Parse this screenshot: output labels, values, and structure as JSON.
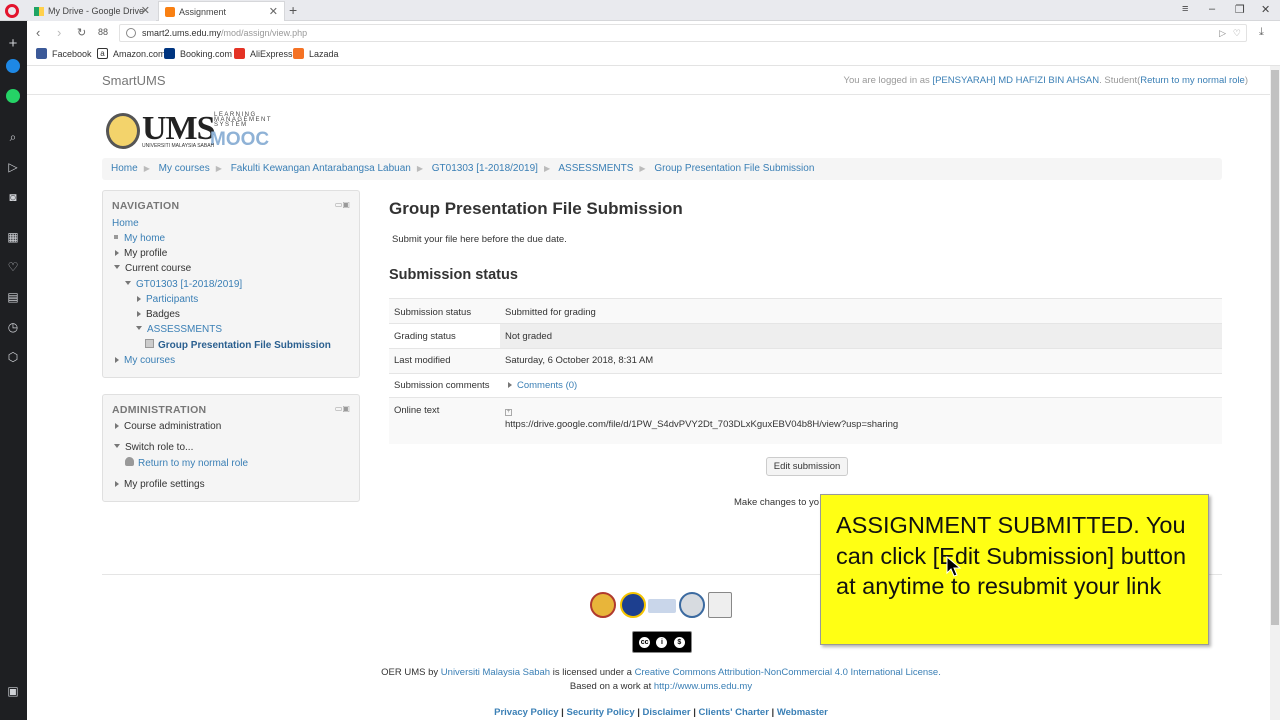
{
  "browser": {
    "tabs": [
      {
        "title": "My Drive - Google Drive",
        "active": false
      },
      {
        "title": "Assignment",
        "active": true
      }
    ],
    "url_host": "smart2.ums.edu.my",
    "url_path": "/mod/assign/view.php",
    "speed_dial": "88",
    "bookmarks": [
      "Facebook",
      "Amazon.com",
      "Booking.com",
      "AliExpress",
      "Lazada"
    ]
  },
  "site": {
    "brand": "SmartUMS",
    "login_prefix": "You are logged in as ",
    "login_user": "[PENSYARAH] MD HAFIZI BIN AHSAN",
    "login_role": ". Student(",
    "login_return": "Return to my normal role",
    "login_close": ")"
  },
  "logo": {
    "ums": "UMS",
    "lms": "LEARNING MANAGEMENT SYSTEM",
    "mooc": "MOOC",
    "sub": "UNIVERSITI MALAYSIA SABAH"
  },
  "breadcrumb": [
    "Home",
    "My courses",
    "Fakulti Kewangan Antarabangsa Labuan",
    "GT01303 [1-2018/2019]",
    "ASSESSMENTS",
    "Group Presentation File Submission"
  ],
  "navigation": {
    "title": "NAVIGATION",
    "home": "Home",
    "my_home": "My home",
    "my_profile": "My profile",
    "current_course": "Current course",
    "course": "GT01303 [1-2018/2019]",
    "participants": "Participants",
    "badges": "Badges",
    "assessments": "ASSESSMENTS",
    "current_item": "Group Presentation File Submission",
    "my_courses": "My courses"
  },
  "administration": {
    "title": "ADMINISTRATION",
    "course_admin": "Course administration",
    "switch_role": "Switch role to...",
    "return_role": "Return to my normal role",
    "profile_settings": "My profile settings"
  },
  "main": {
    "title": "Group Presentation File Submission",
    "intro": "Submit your file here before the due date.",
    "status_heading": "Submission status",
    "rows": {
      "submission_status_label": "Submission status",
      "submission_status_value": "Submitted for grading",
      "grading_status_label": "Grading status",
      "grading_status_value": "Not graded",
      "last_modified_label": "Last modified",
      "last_modified_value": "Saturday, 6 October 2018, 8:31 AM",
      "comments_label": "Submission comments",
      "comments_value": "Comments (0)",
      "online_text_label": "Online text",
      "online_text_value": "https://drive.google.com/file/d/1PW_S4dvPVY2Dt_703DLxKguxEBV04b8H/view?usp=sharing"
    },
    "edit_button": "Edit submission",
    "make_changes": "Make changes to yo"
  },
  "callout": {
    "text": "ASSIGNMENT SUBMITTED. You can click [Edit Submission] button at anytime to resubmit your link"
  },
  "footer": {
    "license_prefix": "OER UMS by ",
    "license_org": "Universiti Malaysia Sabah",
    "license_mid": " is licensed under a ",
    "license_link": "Creative Commons Attribution-NonCommercial 4.0 International License.",
    "based_prefix": "Based on a work at ",
    "based_link": "http://www.ums.edu.my",
    "links": [
      "Privacy Policy",
      "Security Policy",
      "Disclaimer",
      "Clients' Charter",
      "Webmaster"
    ],
    "cc_label": "BY NC"
  },
  "colors": {
    "accent_link": "#3a7fb5",
    "callout_bg": "#ffff14",
    "opera_red": "#e3142d"
  }
}
